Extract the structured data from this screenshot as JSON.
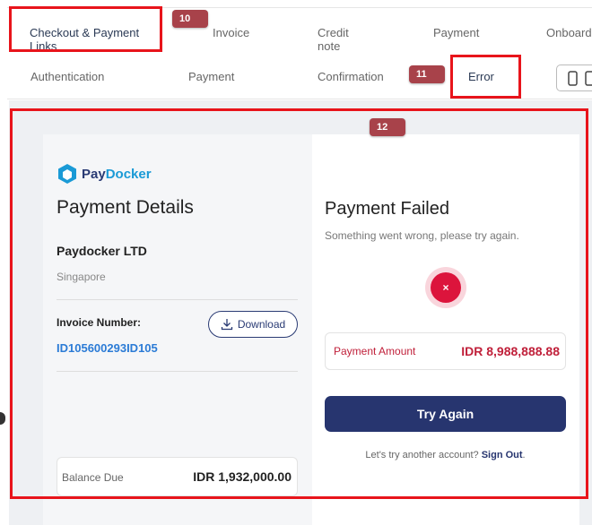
{
  "tabs_row1": [
    {
      "label": "Checkout & Payment Links",
      "active": true
    },
    {
      "label": "Invoice"
    },
    {
      "label": "Credit note"
    },
    {
      "label": "Payment"
    },
    {
      "label": "Onboard"
    }
  ],
  "tabs_row2": [
    {
      "label": "Authentication"
    },
    {
      "label": "Payment"
    },
    {
      "label": "Confirmation"
    },
    {
      "label": "Error",
      "active": true
    }
  ],
  "badges": {
    "b10": "10",
    "b11": "11",
    "b12": "12"
  },
  "brand": {
    "part1": "Pay",
    "part2": "Docker"
  },
  "details": {
    "title": "Payment Details",
    "company": "Paydocker LTD",
    "country": "Singapore",
    "invoice_label": "Invoice Number:",
    "invoice_number": "ID105600293ID105",
    "download_label": "Download",
    "balance_label": "Balance Due",
    "balance_value": "IDR 1,932,000.00"
  },
  "result": {
    "title": "Payment Failed",
    "subtitle": "Something went wrong, please try again.",
    "icon_glyph": "×",
    "amount_label": "Payment Amount",
    "amount_value": "IDR 8,988,888.88",
    "button_label": "Try Again",
    "another_text": "Let's try another account?",
    "signout_label": "Sign Out",
    "period": "."
  },
  "colors": {
    "brand_navy": "#27356f",
    "brand_blue": "#1a9ad6",
    "error_red": "#dc143c",
    "annotation_red": "#e8141b"
  }
}
